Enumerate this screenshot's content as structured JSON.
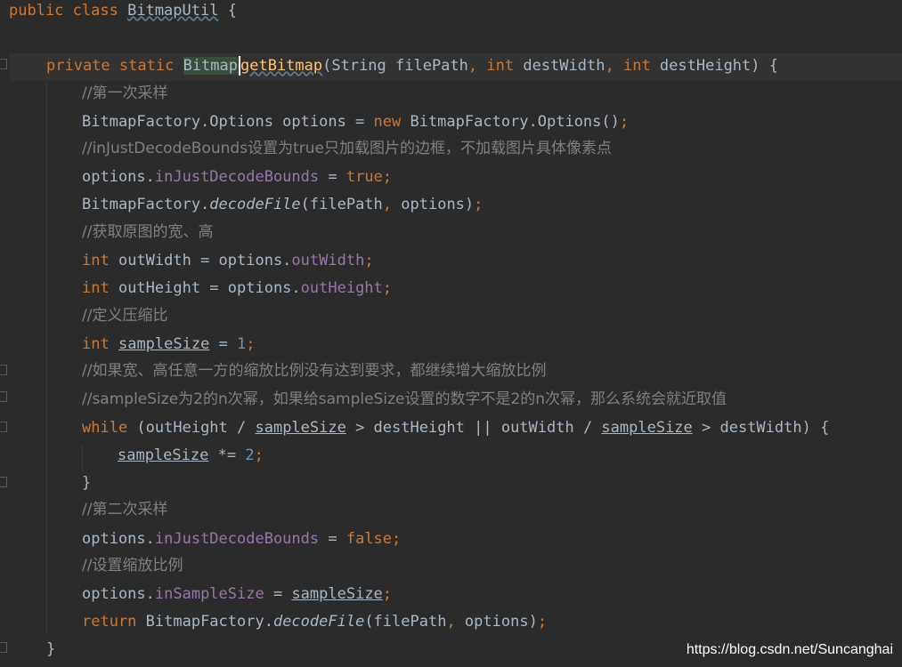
{
  "editor": {
    "lines": {
      "l1": {
        "kw1": "public",
        "kw2": "class",
        "name": "BitmapUtil",
        "brace": " {"
      },
      "l2": {
        "kw1": "private",
        "kw2": "static",
        "ret": "Bitmap",
        "fn": "getBitmap",
        "p1": "(String filePath",
        "comma1": ",",
        "kw3": "int",
        "p2": " destWidth",
        "comma2": ",",
        "kw4": "int",
        "p3": " destHeight) {"
      },
      "l3": {
        "cmt": "//第一次采样"
      },
      "l4": {
        "a": "BitmapFactory.Options options = ",
        "kw": "new",
        "b": " BitmapFactory.Options()",
        "semi": ";"
      },
      "l5": {
        "cmt": "//inJustDecodeBounds设置为true只加载图片的边框，不加载图片具体像素点"
      },
      "l6": {
        "a": "options.",
        "fld": "inJustDecodeBounds",
        "b": " = ",
        "kw": "true",
        "semi": ";"
      },
      "l7": {
        "a": "BitmapFactory.",
        "it": "decodeFile",
        "b": "(filePath",
        "comma": ",",
        "c": " options)",
        "semi": ";"
      },
      "l8": {
        "cmt": "//获取原图的宽、高"
      },
      "l9": {
        "kw": "int",
        "a": " outWidth = options.",
        "fld": "outWidth",
        "semi": ";"
      },
      "l10": {
        "kw": "int",
        "a": " outHeight = options.",
        "fld": "outHeight",
        "semi": ";"
      },
      "l11": {
        "cmt": "//定义压缩比"
      },
      "l12": {
        "kw": "int",
        "var": "sampleSize",
        "a": " = ",
        "num": "1",
        "semi": ";"
      },
      "l13": {
        "cmt": "//如果宽、高任意一方的缩放比例没有达到要求，都继续增大缩放比例"
      },
      "l14": {
        "cmt": "//sampleSize为2的n次幂，如果给sampleSize设置的数字不是2的n次幂，那么系统会就近取值"
      },
      "l15": {
        "kw": "while",
        "a": " (outHeight / ",
        "var1": "sampleSize",
        "b": " > destHeight || outWidth / ",
        "var2": "sampleSize",
        "c": " > destWidth) {"
      },
      "l16": {
        "var": "sampleSize",
        "a": " *= ",
        "num": "2",
        "semi": ";"
      },
      "l17": {
        "a": "}"
      },
      "l18": {
        "cmt": "//第二次采样"
      },
      "l19": {
        "a": "options.",
        "fld": "inJustDecodeBounds",
        "b": " = ",
        "kw": "false",
        "semi": ";"
      },
      "l20": {
        "cmt": "//设置缩放比例"
      },
      "l21": {
        "a": "options.",
        "fld": "inSampleSize",
        "b": " = ",
        "var": "sampleSize",
        "semi": ";"
      },
      "l22": {
        "kw": "return",
        "a": " BitmapFactory.",
        "it": "decodeFile",
        "b": "(filePath",
        "comma": ",",
        "c": " options)",
        "semi": ";"
      },
      "l23": {
        "a": "}"
      }
    }
  },
  "watermark": "https://blog.csdn.net/Suncanghai"
}
